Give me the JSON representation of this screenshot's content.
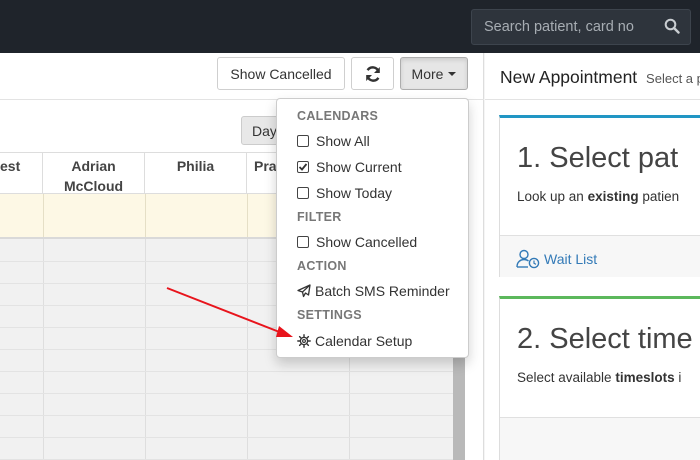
{
  "search": {
    "placeholder": "Search patient, card no",
    "icon": "search-icon"
  },
  "toolbar": {
    "show_cancelled_label": "Show Cancelled",
    "refresh_icon": "refresh-icon",
    "more_label": "More",
    "day_label": "Day"
  },
  "calendar": {
    "columns": [
      {
        "label": "est"
      },
      {
        "label": "Adrian McCloud"
      },
      {
        "label": "Philia"
      },
      {
        "label": "Pra"
      }
    ]
  },
  "menu": {
    "calendars_header": "CALENDARS",
    "show_all": "Show All",
    "show_current": "Show Current",
    "show_today": "Show Today",
    "filter_header": "FILTER",
    "show_cancelled": "Show Cancelled",
    "action_header": "ACTION",
    "batch_sms": "Batch SMS Reminder",
    "settings_header": "SETTINGS",
    "calendar_setup": "Calendar Setup",
    "checked": {
      "show_all": false,
      "show_current": true,
      "show_today": false,
      "show_cancelled": false
    }
  },
  "new_appointment": {
    "title": "New Appointment",
    "subtitle": "Select a p",
    "step1_title": "1. Select pat",
    "step1_text_prefix": "Look up an",
    "step1_text_bold": "existing",
    "step1_text_suffix": "patien",
    "wait_list": "Wait List",
    "step2_title": "2. Select time",
    "step2_text_prefix": "Select available",
    "step2_text_bold": "timeslots",
    "step2_text_suffix": "i"
  },
  "colors": {
    "topbar": "#1f242b",
    "accent_blue": "#2196c4",
    "accent_green": "#5cb85c",
    "link": "#337ab7",
    "allday_bg": "#fdf8e5",
    "annotation_arrow": "#e8141c"
  }
}
